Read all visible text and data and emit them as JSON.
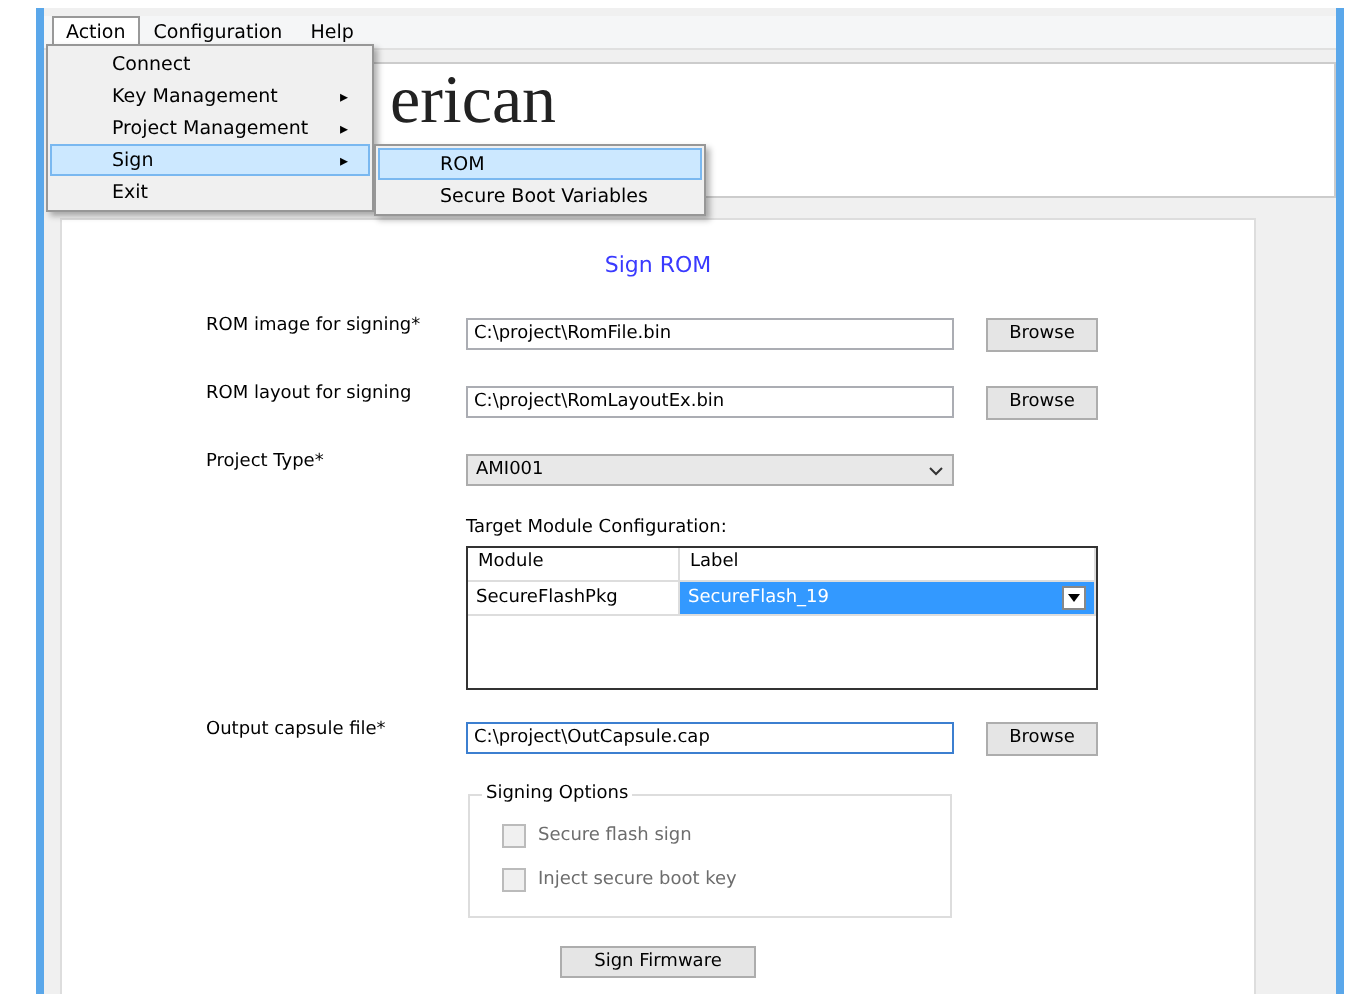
{
  "menu_bar": [
    {
      "label": "Action",
      "selected": true
    },
    {
      "label": "Configuration",
      "selected": false
    },
    {
      "label": "Help",
      "selected": false
    }
  ],
  "action_menu": [
    {
      "label": "Connect",
      "submenu": false,
      "selected": false
    },
    {
      "label": "Key Management",
      "submenu": true,
      "selected": false
    },
    {
      "label": "Project Management",
      "submenu": true,
      "selected": false
    },
    {
      "label": "Sign",
      "submenu": true,
      "selected": true
    },
    {
      "label": "Exit",
      "submenu": false,
      "selected": false
    }
  ],
  "sign_submenu": [
    {
      "label": "ROM",
      "selected": true
    },
    {
      "label": "Secure Boot Variables",
      "selected": false
    }
  ],
  "submenu_arrow": "▸",
  "header": {
    "logo_text": "erican"
  },
  "form": {
    "title": "Sign ROM",
    "file_rows": [
      {
        "label": "ROM image for signing*",
        "value": "C:\\project\\RomFile.bin",
        "button": "Browse",
        "focused": false
      },
      {
        "label": "ROM layout for signing",
        "value": "C:\\project\\RomLayoutEx.bin",
        "button": "Browse",
        "focused": false
      }
    ],
    "project_type": {
      "label": "Project Type*",
      "value": "AMI001"
    },
    "target_module": {
      "label": "Target Module Configuration:",
      "columns": [
        "Module",
        "Label"
      ],
      "rows": [
        {
          "module": "SecureFlashPkg",
          "label": "SecureFlash_19",
          "selected": true
        }
      ]
    },
    "output": {
      "label": "Output capsule file*",
      "value": "C:\\project\\OutCapsule.cap",
      "button": "Browse",
      "focused": true
    },
    "signing_options": {
      "title": "Signing Options",
      "options": [
        {
          "label": "Secure flash sign",
          "checked": false,
          "disabled": true
        },
        {
          "label": "Inject secure boot key",
          "checked": false,
          "disabled": true
        }
      ]
    },
    "submit": "Sign Firmware"
  }
}
